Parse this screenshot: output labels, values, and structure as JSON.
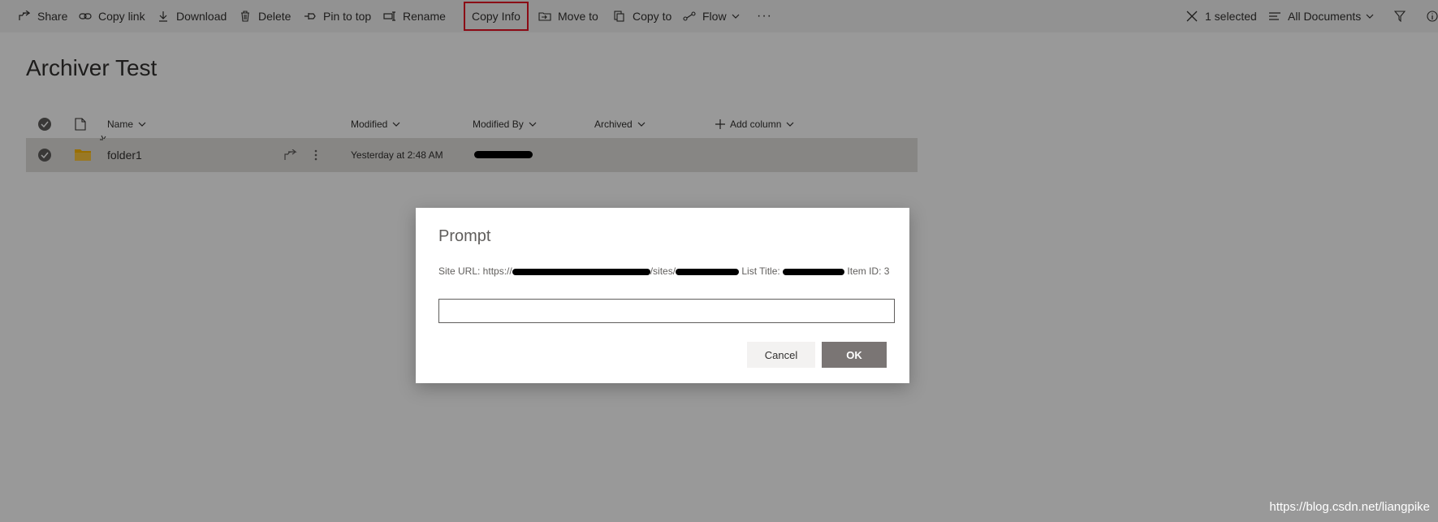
{
  "toolbar": {
    "share": "Share",
    "copy_link": "Copy link",
    "download": "Download",
    "delete": "Delete",
    "pin_to_top": "Pin to top",
    "rename": "Rename",
    "copy_info": "Copy Info",
    "move_to": "Move to",
    "copy_to": "Copy to",
    "flow": "Flow",
    "more": "···",
    "selected": "1 selected",
    "view": "All Documents"
  },
  "page": {
    "title": "Archiver Test"
  },
  "list": {
    "columns": {
      "name": "Name",
      "modified": "Modified",
      "modified_by": "Modified By",
      "archived": "Archived",
      "add_column": "Add column"
    },
    "rows": [
      {
        "name": "folder1",
        "modified": "Yesterday at 2:48 AM",
        "modified_by": "",
        "archived": ""
      }
    ]
  },
  "dialog": {
    "title": "Prompt",
    "message": {
      "prefix": "Site URL: https://",
      "part2": "/sites/",
      "part3": " List Title: ",
      "part4": " Item ID: 3"
    },
    "input_value": "",
    "cancel": "Cancel",
    "ok": "OK"
  },
  "watermark": "https://blog.csdn.net/liangpike",
  "colors": {
    "highlight": "#e81123",
    "ok_button": "#7a7574",
    "selected_row": "#e1dfdd",
    "folder": "#ffb900"
  }
}
